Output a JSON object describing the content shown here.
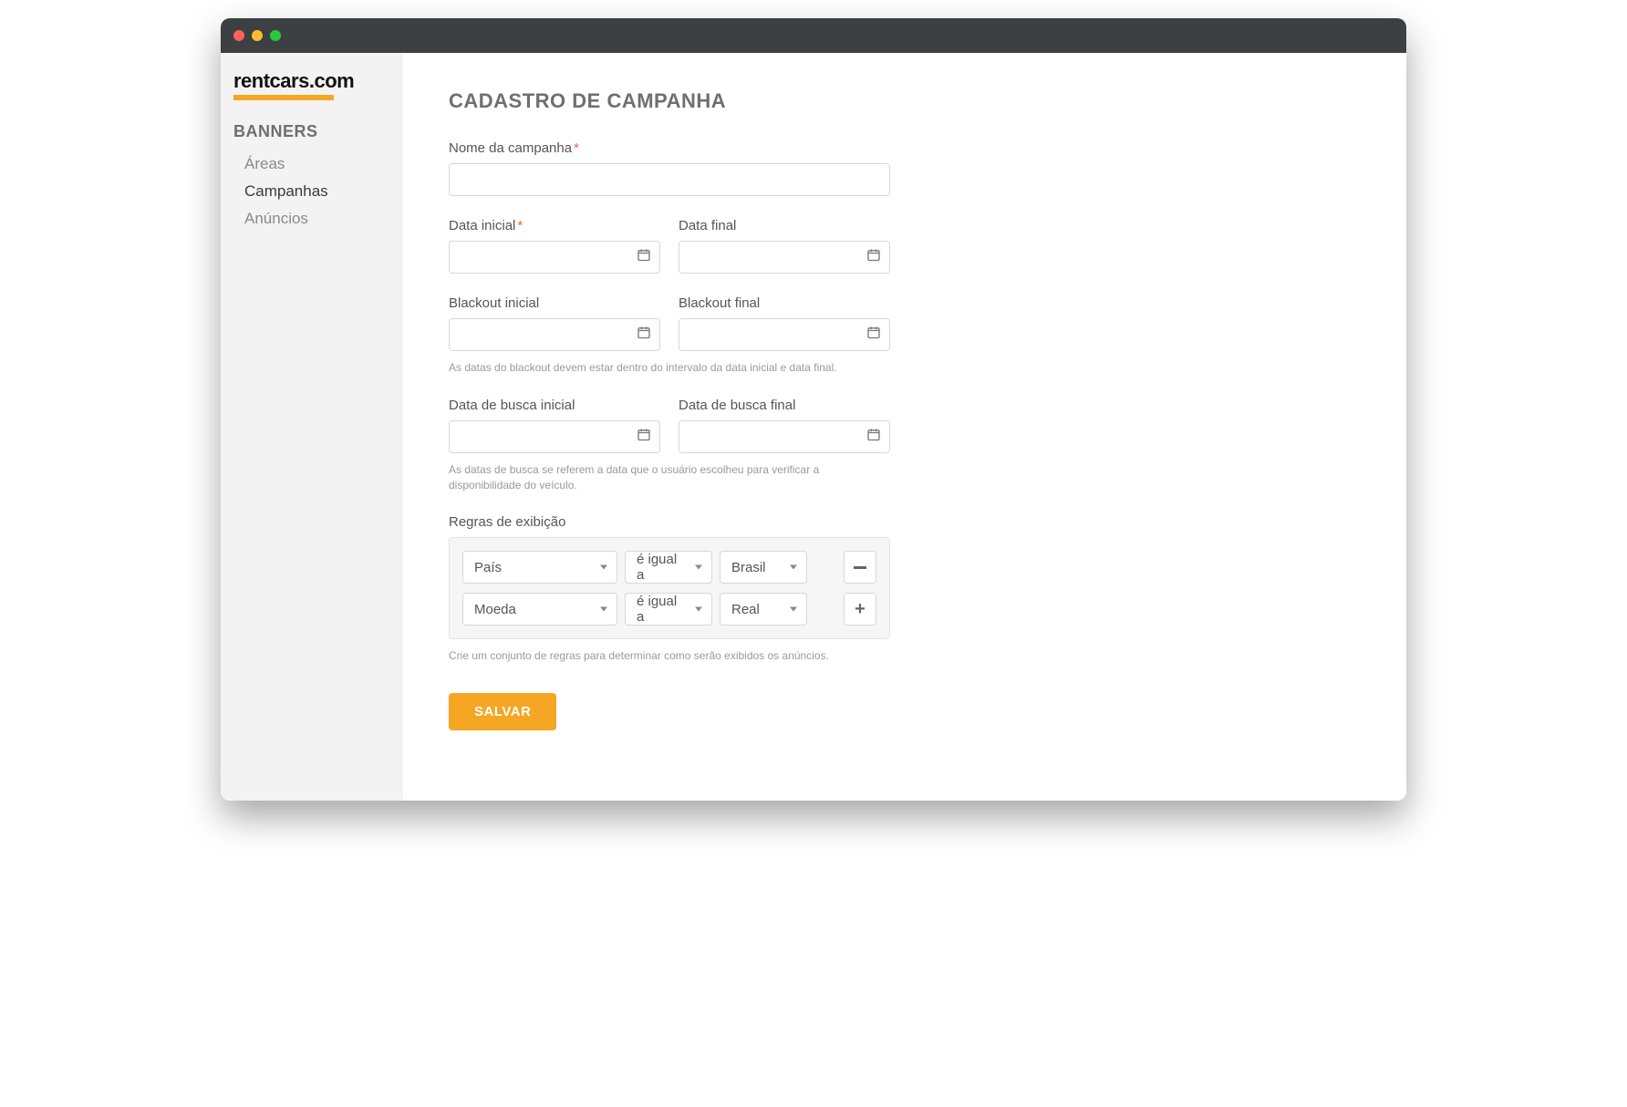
{
  "logo": {
    "brand": "rentcars",
    "suffix": ".com"
  },
  "sidebar": {
    "section_title": "BANNERS",
    "items": [
      {
        "label": "Áreas",
        "active": false
      },
      {
        "label": "Campanhas",
        "active": true
      },
      {
        "label": "Anúncios",
        "active": false
      }
    ]
  },
  "page": {
    "title": "CADASTRO DE CAMPANHA"
  },
  "form": {
    "campaign_name": {
      "label": "Nome da campanha",
      "required": true,
      "value": ""
    },
    "start_date": {
      "label": "Data inicial",
      "required": true,
      "value": ""
    },
    "end_date": {
      "label": "Data final",
      "required": false,
      "value": ""
    },
    "blackout_start": {
      "label": "Blackout inicial",
      "value": ""
    },
    "blackout_end": {
      "label": "Blackout final",
      "value": ""
    },
    "blackout_hint": "As datas do blackout devem estar dentro do intervalo da data inicial e data final.",
    "search_start": {
      "label": "Data de busca inicial",
      "value": ""
    },
    "search_end": {
      "label": "Data de busca final",
      "value": ""
    },
    "search_hint": "As datas de busca se referem a data que o usuário escolheu para verificar a disponibilidade do veículo.",
    "rules_label": "Regras de exibição",
    "rules": [
      {
        "field": "País",
        "operator": "é igual a",
        "value": "Brasil",
        "action": "remove"
      },
      {
        "field": "Moeda",
        "operator": "é igual a",
        "value": "Real",
        "action": "add"
      }
    ],
    "rules_hint": "Crie um conjunto de regras para determinar como serão exibidos os anúncios.",
    "save_label": "SALVAR"
  }
}
